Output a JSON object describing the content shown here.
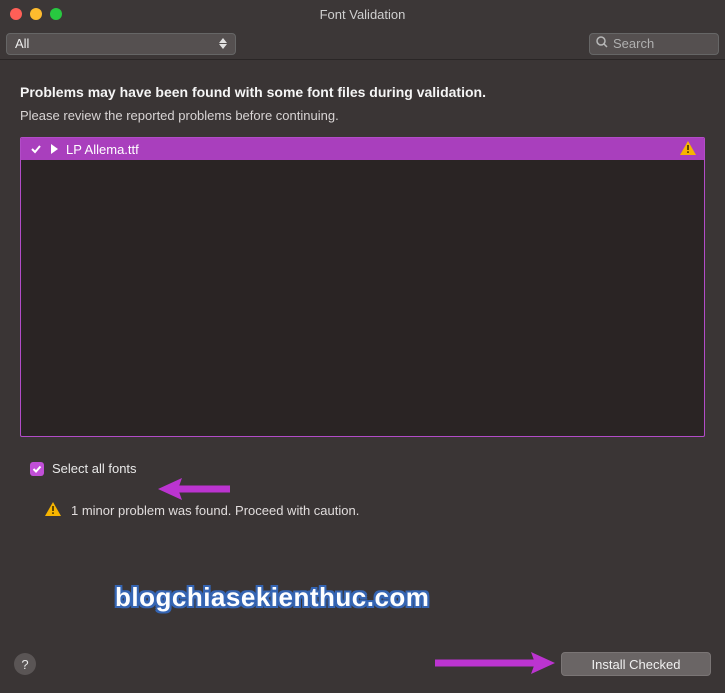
{
  "window": {
    "title": "Font Validation"
  },
  "toolbar": {
    "filter_value": "All",
    "search_placeholder": "Search"
  },
  "message": {
    "heading": "Problems may have been found with some font files during validation.",
    "subheading": "Please review the reported problems before continuing."
  },
  "font_list": [
    {
      "name": "LP Allema.ttf",
      "checked": true,
      "has_warning": true
    }
  ],
  "select_all": {
    "label": "Select all fonts",
    "checked": true
  },
  "status": {
    "text": "1 minor problem was found. Proceed with caution."
  },
  "footer": {
    "help_label": "?",
    "install_button": "Install Checked"
  },
  "watermark": "blogchiasekienthuc.com",
  "colors": {
    "accent": "#a93fbd",
    "arrow": "#bb34d0"
  }
}
